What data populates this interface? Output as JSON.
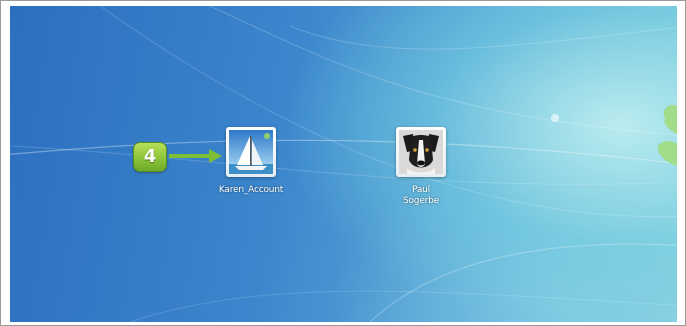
{
  "logon": {
    "users": [
      {
        "name": "Karen_Account",
        "picture": "sailboat-picture"
      },
      {
        "name_lines": [
          "Paul",
          "Sogerbe"
        ],
        "picture": "dog-picture"
      }
    ]
  },
  "callout": {
    "number": "4",
    "color": "#8cc43a"
  },
  "icons": {
    "pointer": "arrow-right-icon"
  }
}
